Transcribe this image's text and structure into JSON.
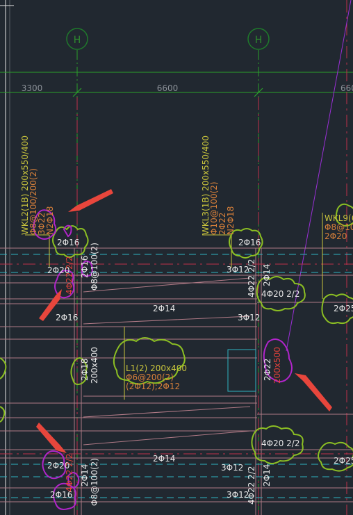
{
  "colors": {
    "background": "#212830",
    "axis_line": "#2aa02a",
    "grid_bubble": "#1f7a2b",
    "beam_edge": "#b07a86",
    "dashed_cyan": "#2fb3c2",
    "cloud_green": "#8cbf23",
    "cloud_magenta": "#b025c9",
    "arrow_red": "#e8463c",
    "annot_yellow": "#c9c43c",
    "annot_orange": "#d8803a",
    "rebar_text": "#e6e6e6",
    "leader_violet": "#9a2fd6"
  },
  "grid_axes": {
    "bubble_left": "H",
    "bubble_right": "H",
    "dims": [
      "3300",
      "6600",
      "660"
    ]
  },
  "labels": {
    "wkl2_a": "WKL2(1B) 200x550/400",
    "wkl2_b": "Φ8@100/200(2)",
    "wkl2_c": "3Φ22",
    "wkl2_d": "N2Φ18",
    "wkl3_a": "WKL3(1B) 200x550/400",
    "wkl3_b": "Φ10@100(2)",
    "wkl3_c": "2Φ22",
    "wkl3_d": "N2Φ18",
    "wkl9_a": "WKL9(6)",
    "wkl9_b": "Φ8@10",
    "wkl9_c": "2Φ20",
    "r_2c16_a": "2Φ16",
    "r_2c16_b": "2Φ16",
    "r_2c20_a": "2Φ20",
    "r_2c16_v": "2Φ16",
    "r_c8_v": "Φ8@100(2)",
    "r_4c22_v": "4Φ22 2/2",
    "r_3c12_a": "3Φ12",
    "r_4c22_v2": "4Φ22 2/2",
    "r_2c14_v": "2Φ14",
    "r_4c20_a": "4Φ20 2/2",
    "r_2c25_a": "2Φ25",
    "r_2c16_c": "2Φ16",
    "r_2c14_h": "2Φ14",
    "r_3c12_b": "3Φ12",
    "r_2c18_v": "2Φ18",
    "r_200x400_v": "200x400",
    "l1_a": "L1(2) 200x400",
    "l1_b": "Φ6@200(2)",
    "l1_c": "(2Φ12);2Φ12",
    "r_2c22_v": "2Φ22",
    "r_200x500_v": "200x500",
    "r_4c20_b": "4Φ20 2/2",
    "r_2c20_b": "2Φ20",
    "r_2c14_h2": "2Φ14",
    "r_3c12_c": "3Φ12",
    "r_2c25_b": "2Φ25",
    "r_4c22_v3": "4Φ22 2/2",
    "r_2c14_v2": "2Φ14",
    "r_c8_v2": "Φ8@100(2)",
    "r_4c22_v4": "4Φ22 2/2",
    "r_2c14_v3": "2Φ14",
    "r_2c16_d": "2Φ16",
    "r_3c12_d": "3Φ12"
  }
}
